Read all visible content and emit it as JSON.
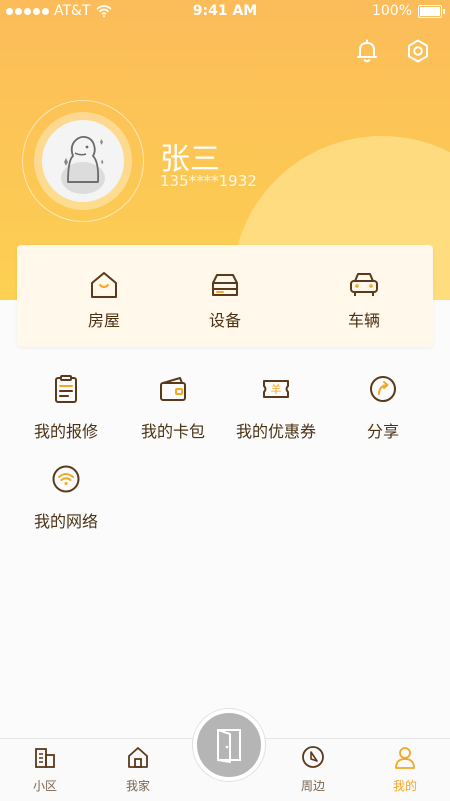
{
  "status_bar": {
    "carrier": "AT&T",
    "time": "9:41 AM",
    "battery": "100%"
  },
  "header": {
    "icons": [
      "bell-icon",
      "settings-hexagon-icon"
    ]
  },
  "profile": {
    "name": "张三",
    "phone": "135****1932"
  },
  "assets_card": {
    "items": [
      {
        "label": "房屋",
        "icon": "house-icon"
      },
      {
        "label": "设备",
        "icon": "device-icon"
      },
      {
        "label": "车辆",
        "icon": "car-icon"
      }
    ]
  },
  "services": {
    "items": [
      {
        "label": "我的报修",
        "icon": "repair-clipboard-icon"
      },
      {
        "label": "我的卡包",
        "icon": "card-wallet-icon"
      },
      {
        "label": "我的优惠券",
        "icon": "coupon-icon"
      },
      {
        "label": "分享",
        "icon": "share-icon"
      },
      {
        "label": "我的网络",
        "icon": "wifi-icon"
      }
    ]
  },
  "tabbar": {
    "tabs": [
      {
        "label": "小区",
        "icon": "building-icon",
        "active": false
      },
      {
        "label": "我家",
        "icon": "home-icon",
        "active": false
      },
      {
        "label": "周边",
        "icon": "compass-icon",
        "active": false
      },
      {
        "label": "我的",
        "icon": "person-icon",
        "active": true
      }
    ],
    "center_button_icon": "door-icon"
  },
  "colors": {
    "header_top": "#fbbc59",
    "header_bottom": "#fdd052",
    "card_bg": "#fff8eb",
    "icon_stroke": "#5a3a1a",
    "active_tab": "#f5a623"
  }
}
